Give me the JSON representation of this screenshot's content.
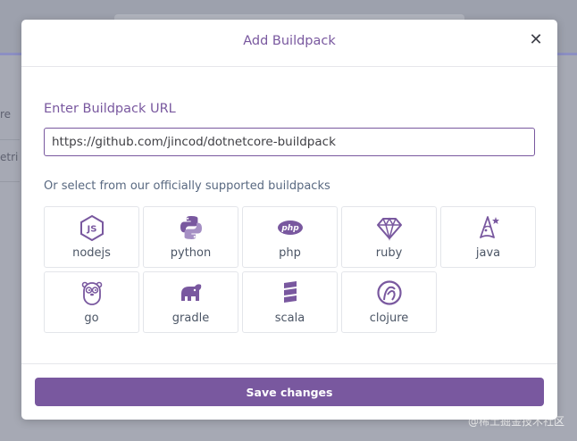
{
  "modal": {
    "title": "Add Buildpack",
    "close_glyph": "✕",
    "url_label": "Enter Buildpack URL",
    "url_value": "https://github.com/jincod/dotnetcore-buildpack",
    "select_label": "Or select from our officially supported buildpacks",
    "save_label": "Save changes"
  },
  "buildpacks": [
    {
      "label": "nodejs",
      "icon": "nodejs-icon"
    },
    {
      "label": "python",
      "icon": "python-icon"
    },
    {
      "label": "php",
      "icon": "php-icon"
    },
    {
      "label": "ruby",
      "icon": "ruby-icon"
    },
    {
      "label": "java",
      "icon": "java-icon"
    },
    {
      "label": "go",
      "icon": "go-icon"
    },
    {
      "label": "gradle",
      "icon": "gradle-icon"
    },
    {
      "label": "scala",
      "icon": "scala-icon"
    },
    {
      "label": "clojure",
      "icon": "clojure-icon"
    }
  ],
  "background": {
    "partial_labels": [
      "re",
      "etri"
    ],
    "watermark": "@稀土掘金技术社区"
  },
  "colors": {
    "accent": "#79589f",
    "overlay": "#a6a9b4"
  }
}
